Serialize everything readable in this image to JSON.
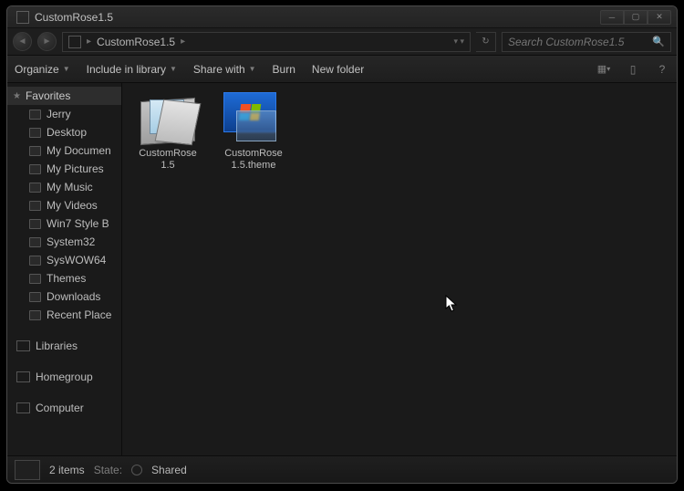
{
  "window": {
    "title": "CustomRose1.5"
  },
  "breadcrumb": {
    "current": "CustomRose1.5"
  },
  "search": {
    "placeholder": "Search CustomRose1.5"
  },
  "toolbar": {
    "organize": "Organize",
    "include_in_library": "Include in library",
    "share_with": "Share with",
    "burn": "Burn",
    "new_folder": "New folder"
  },
  "sidebar": {
    "favorites_header": "Favorites",
    "favorites": [
      {
        "label": "Jerry"
      },
      {
        "label": "Desktop"
      },
      {
        "label": "My Documen"
      },
      {
        "label": "My Pictures"
      },
      {
        "label": "My Music"
      },
      {
        "label": "My Videos"
      },
      {
        "label": "Win7 Style B"
      },
      {
        "label": "System32"
      },
      {
        "label": "SysWOW64"
      },
      {
        "label": "Themes"
      },
      {
        "label": "Downloads"
      },
      {
        "label": "Recent Place"
      }
    ],
    "sections": {
      "libraries": "Libraries",
      "homegroup": "Homegroup",
      "computer": "Computer"
    }
  },
  "files": [
    {
      "name_line1": "CustomRose",
      "name_line2": "1.5",
      "type": "folder"
    },
    {
      "name_line1": "CustomRose",
      "name_line2": "1.5.theme",
      "type": "theme"
    }
  ],
  "status": {
    "count_text": "2 items",
    "state_label": "State:",
    "state_value": "Shared"
  }
}
